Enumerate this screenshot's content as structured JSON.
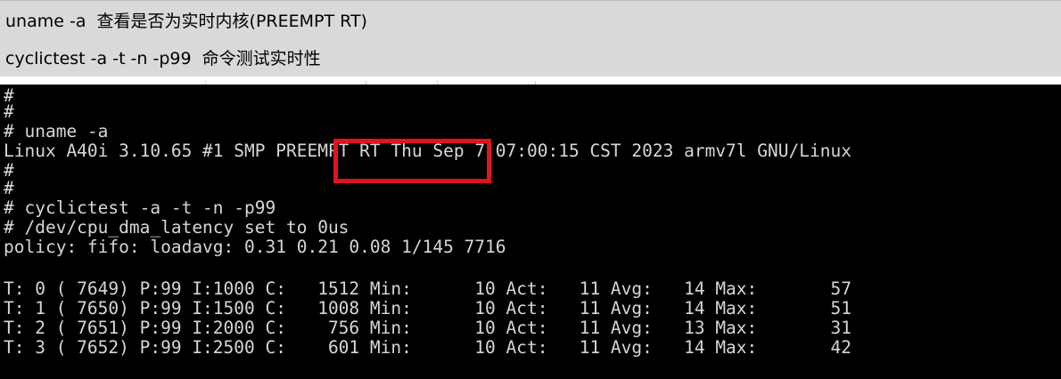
{
  "notes": {
    "line1": "uname -a  查看是否为实时内核(PREEMPT RT)",
    "line2": "cyclictest -a -t -n -p99  命令测试实时性"
  },
  "terminal": {
    "lines": [
      "#",
      "#",
      "# uname -a",
      "Linux A40i 3.10.65 #1 SMP PREEMPT RT Thu Sep 7 07:00:15 CST 2023 armv7l GNU/Linux",
      "#",
      "#",
      "# cyclictest -a -t -n -p99",
      "# /dev/cpu_dma_latency set to 0us",
      "policy: fifo: loadavg: 0.31 0.21 0.08 1/145 7716",
      "",
      "T: 0 ( 7649) P:99 I:1000 C:   1512 Min:      10 Act:   11 Avg:   14 Max:       57",
      "T: 1 ( 7650) P:99 I:1500 C:   1008 Min:      10 Act:   11 Avg:   14 Max:       51",
      "T: 2 ( 7651) P:99 I:2000 C:    756 Min:      10 Act:   11 Avg:   13 Max:       31",
      "T: 3 ( 7652) P:99 I:2500 C:    601 Min:      10 Act:   11 Avg:   14 Max:       42"
    ],
    "highlight_text": "PREEMPT RT",
    "highlight_color": "#e0141e",
    "text_color": "#d6d6d6",
    "background_color": "#000000"
  }
}
